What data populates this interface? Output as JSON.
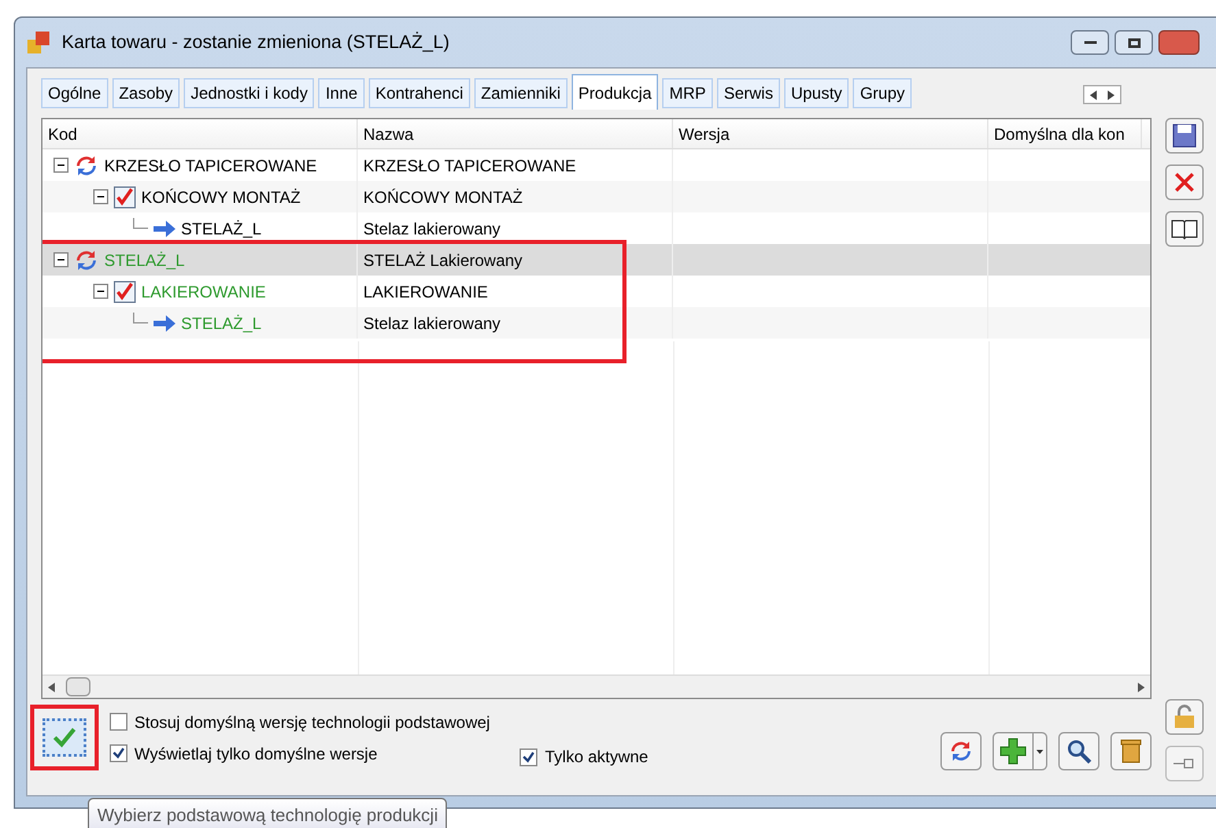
{
  "window": {
    "title": "Karta towaru - zostanie zmieniona (STELAŻ_L)"
  },
  "tabs": [
    {
      "label": "Ogólne",
      "selected": false
    },
    {
      "label": "Zasoby",
      "selected": false
    },
    {
      "label": "Jednostki i kody",
      "selected": false
    },
    {
      "label": "Inne",
      "selected": false
    },
    {
      "label": "Kontrahenci",
      "selected": false
    },
    {
      "label": "Zamienniki",
      "selected": false
    },
    {
      "label": "Produkcja",
      "selected": true
    },
    {
      "label": "MRP",
      "selected": false
    },
    {
      "label": "Serwis",
      "selected": false
    },
    {
      "label": "Upusty",
      "selected": false
    },
    {
      "label": "Grupy",
      "selected": false
    }
  ],
  "table": {
    "columns": [
      "Kod",
      "Nazwa",
      "Wersja",
      "Domyślna dla kon"
    ],
    "rows": [
      {
        "kind": "technology",
        "code": "KRZESŁO TAPICEROWANE",
        "name": "KRZESŁO TAPICEROWANE",
        "highlighted": false,
        "selected": false,
        "expanded": true,
        "children": [
          {
            "kind": "operation",
            "code": "KOŃCOWY MONTAŻ",
            "name": "KOŃCOWY MONTAŻ",
            "highlighted": false,
            "selected": false,
            "expanded": true,
            "children": [
              {
                "kind": "product",
                "code": "STELAŻ_L",
                "name": "Stelaz lakierowany",
                "highlighted": false,
                "selected": false
              }
            ]
          }
        ]
      },
      {
        "kind": "technology",
        "code": "STELAŻ_L",
        "name": "STELAŻ Lakierowany",
        "highlighted": true,
        "selected": true,
        "expanded": true,
        "children": [
          {
            "kind": "operation",
            "code": "LAKIEROWANIE",
            "name": "LAKIEROWANIE",
            "highlighted": true,
            "selected": false,
            "expanded": true,
            "children": [
              {
                "kind": "product",
                "code": "STELAŻ_L",
                "name": "Stelaz lakierowany",
                "highlighted": true,
                "selected": false
              }
            ]
          }
        ]
      }
    ]
  },
  "options": [
    {
      "label": "Stosuj domyślną wersję technologii podstawowej",
      "checked": false
    },
    {
      "label": "Wyświetlaj tylko domyślne wersje",
      "checked": true
    }
  ],
  "only_active": {
    "label": "Tylko aktywne",
    "checked": true
  },
  "tooltip": "Wybierz podstawową technologię produkcji"
}
